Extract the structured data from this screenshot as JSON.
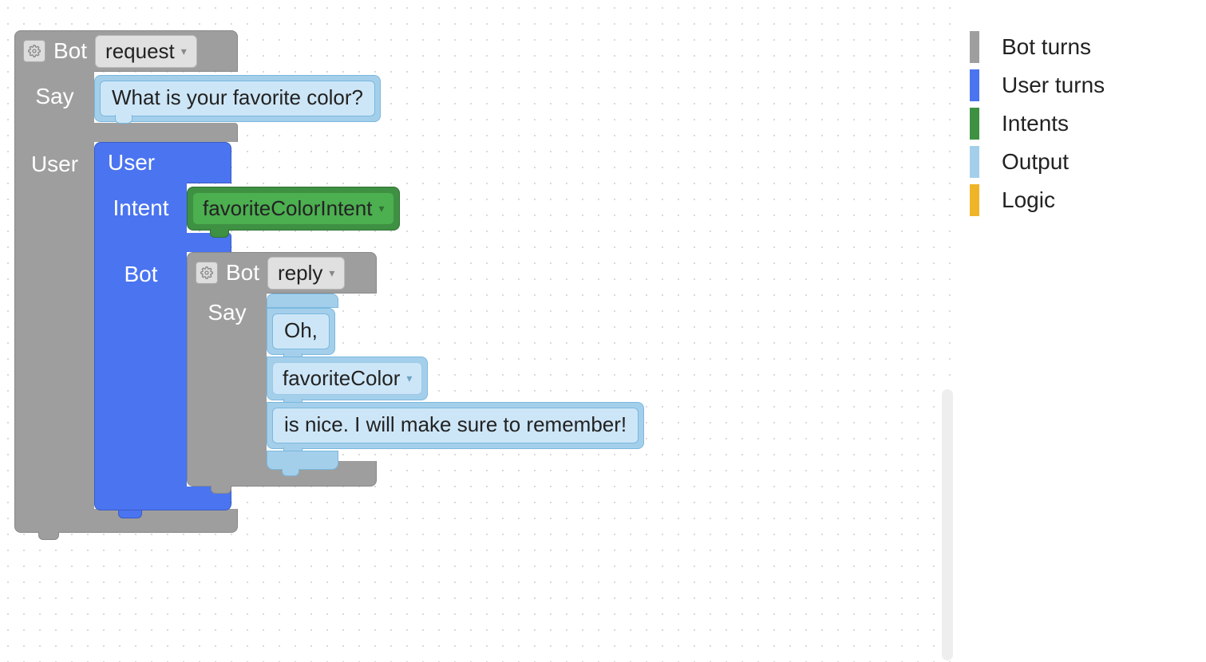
{
  "colors": {
    "botTurns": "#9e9e9e",
    "userTurns": "#4a74f0",
    "intents": "#3e9142",
    "output": "#a4cfeb",
    "logic": "#f0b429"
  },
  "legend": [
    {
      "key": "botTurns",
      "label": "Bot turns"
    },
    {
      "key": "userTurns",
      "label": "User turns"
    },
    {
      "key": "intents",
      "label": "Intents"
    },
    {
      "key": "output",
      "label": "Output"
    },
    {
      "key": "logic",
      "label": "Logic"
    }
  ],
  "outerBlock": {
    "gearAlt": "settings",
    "title": "Bot",
    "typeDropdown": "request",
    "sayLabel": "Say",
    "sayText": "What is your favorite color?",
    "userLabel": "User"
  },
  "userBlock": {
    "title": "User",
    "intentLabel": "Intent",
    "intentDropdown": "favoriteColorIntent",
    "botLabel": "Bot"
  },
  "innerBotBlock": {
    "gearAlt": "settings",
    "title": "Bot",
    "typeDropdown": "reply",
    "sayLabel": "Say",
    "sayParts": {
      "part1": "Oh,",
      "variableDropdown": "favoriteColor",
      "part2": "is nice. I will make sure to remember!"
    }
  }
}
